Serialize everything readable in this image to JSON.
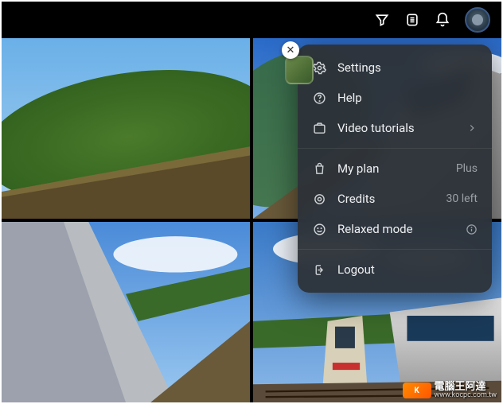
{
  "menu": {
    "settings": "Settings",
    "help": "Help",
    "video_tutorials": "Video tutorials",
    "my_plan": "My plan",
    "my_plan_value": "Plus",
    "credits": "Credits",
    "credits_value": "30 left",
    "relaxed_mode": "Relaxed mode",
    "logout": "Logout"
  },
  "watermark": {
    "title": "電腦王阿達",
    "url": "www.kocpc.com.tw"
  },
  "close_glyph": "✕"
}
